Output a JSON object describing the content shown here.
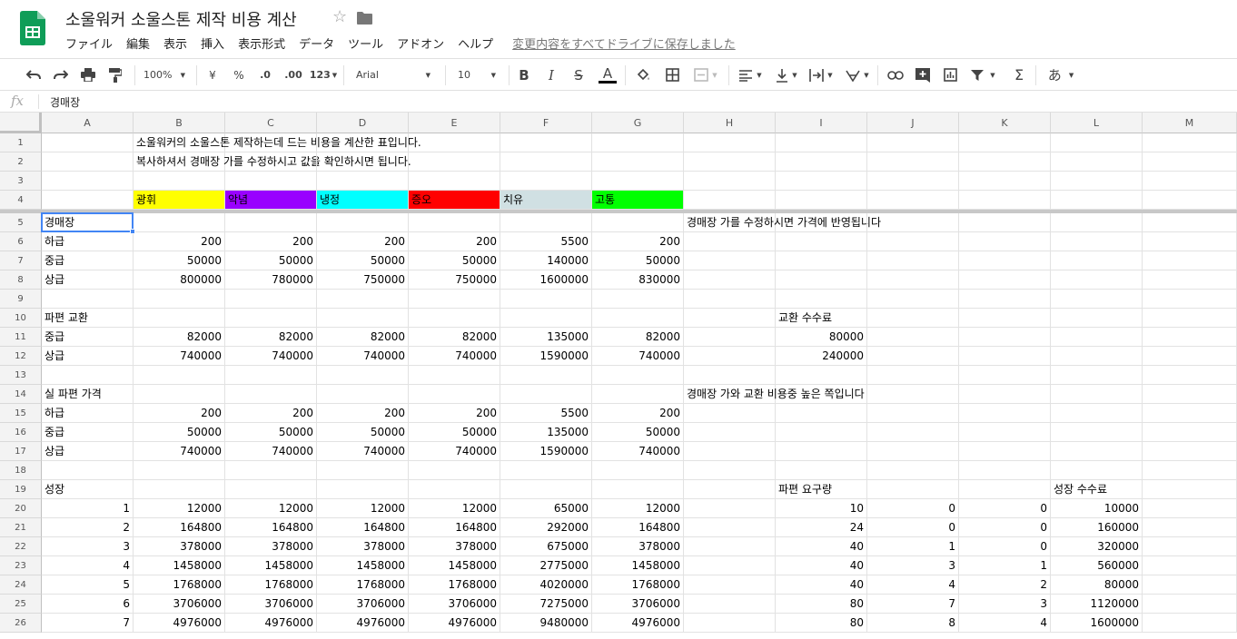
{
  "doc": {
    "title": "소울워커 소울스톤 제작 비용 계산"
  },
  "menu": [
    "ファイル",
    "編集",
    "表示",
    "挿入",
    "表示形式",
    "データ",
    "ツール",
    "アドオン",
    "ヘルプ"
  ],
  "save_status": "変更内容をすべてドライブに保存しました",
  "toolbar": {
    "zoom": "100%",
    "currency": "¥",
    "percent": "%",
    "dec_less": ".0",
    "dec_more": ".00",
    "format_more": "123",
    "font": "Arial",
    "font_size": "10",
    "bold": "B",
    "italic": "I",
    "strike": "S",
    "text_color": "A",
    "input_tools": "あ"
  },
  "formula": {
    "fx": "fx",
    "value": "경매장"
  },
  "columns": [
    "A",
    "B",
    "C",
    "D",
    "E",
    "F",
    "G",
    "H",
    "I",
    "J",
    "K",
    "L",
    "M"
  ],
  "rows": [
    "1",
    "2",
    "3",
    "4",
    "5",
    "6",
    "7",
    "8",
    "9",
    "10",
    "11",
    "12",
    "13",
    "14",
    "15",
    "16",
    "17",
    "18",
    "19",
    "20",
    "21",
    "22",
    "23",
    "24",
    "25",
    "26"
  ],
  "colors": {
    "yellow": "#ffff00",
    "purple": "#9900ff",
    "cyan": "#00ffff",
    "red": "#ff0000",
    "lightgray": "#d0e0e3",
    "green": "#00ff00",
    "selection": "#4285f4"
  },
  "cells": [
    {
      "r": 1,
      "c": "B",
      "t": "소울워커의 소울스톤 제작하는데 드는 비용을 계산한 표입니다."
    },
    {
      "r": 2,
      "c": "B",
      "t": "복사하셔서 경매장 가를 수정하시고 값을 확인하시면 됩니다."
    },
    {
      "r": 4,
      "c": "B",
      "t": "광휘",
      "bg": "yellow"
    },
    {
      "r": 4,
      "c": "C",
      "t": "악념",
      "bg": "purple"
    },
    {
      "r": 4,
      "c": "D",
      "t": "냉정",
      "bg": "cyan"
    },
    {
      "r": 4,
      "c": "E",
      "t": "증오",
      "bg": "red"
    },
    {
      "r": 4,
      "c": "F",
      "t": "치유",
      "bg": "lightgray"
    },
    {
      "r": 4,
      "c": "G",
      "t": "고통",
      "bg": "green"
    },
    {
      "r": 5,
      "c": "A",
      "t": "경매장"
    },
    {
      "r": 5,
      "c": "H",
      "t": "경매장 가를 수정하시면 가격에 반영됩니다"
    },
    {
      "r": 6,
      "c": "A",
      "t": "하급"
    },
    {
      "r": 6,
      "c": "B",
      "t": "200",
      "n": 1
    },
    {
      "r": 6,
      "c": "C",
      "t": "200",
      "n": 1
    },
    {
      "r": 6,
      "c": "D",
      "t": "200",
      "n": 1
    },
    {
      "r": 6,
      "c": "E",
      "t": "200",
      "n": 1
    },
    {
      "r": 6,
      "c": "F",
      "t": "5500",
      "n": 1
    },
    {
      "r": 6,
      "c": "G",
      "t": "200",
      "n": 1
    },
    {
      "r": 7,
      "c": "A",
      "t": "중급"
    },
    {
      "r": 7,
      "c": "B",
      "t": "50000",
      "n": 1
    },
    {
      "r": 7,
      "c": "C",
      "t": "50000",
      "n": 1
    },
    {
      "r": 7,
      "c": "D",
      "t": "50000",
      "n": 1
    },
    {
      "r": 7,
      "c": "E",
      "t": "50000",
      "n": 1
    },
    {
      "r": 7,
      "c": "F",
      "t": "140000",
      "n": 1
    },
    {
      "r": 7,
      "c": "G",
      "t": "50000",
      "n": 1
    },
    {
      "r": 8,
      "c": "A",
      "t": "상급"
    },
    {
      "r": 8,
      "c": "B",
      "t": "800000",
      "n": 1
    },
    {
      "r": 8,
      "c": "C",
      "t": "780000",
      "n": 1
    },
    {
      "r": 8,
      "c": "D",
      "t": "750000",
      "n": 1
    },
    {
      "r": 8,
      "c": "E",
      "t": "750000",
      "n": 1
    },
    {
      "r": 8,
      "c": "F",
      "t": "1600000",
      "n": 1
    },
    {
      "r": 8,
      "c": "G",
      "t": "830000",
      "n": 1
    },
    {
      "r": 10,
      "c": "A",
      "t": "파편 교환"
    },
    {
      "r": 10,
      "c": "I",
      "t": "교환 수수료"
    },
    {
      "r": 11,
      "c": "A",
      "t": "중급"
    },
    {
      "r": 11,
      "c": "B",
      "t": "82000",
      "n": 1
    },
    {
      "r": 11,
      "c": "C",
      "t": "82000",
      "n": 1
    },
    {
      "r": 11,
      "c": "D",
      "t": "82000",
      "n": 1
    },
    {
      "r": 11,
      "c": "E",
      "t": "82000",
      "n": 1
    },
    {
      "r": 11,
      "c": "F",
      "t": "135000",
      "n": 1
    },
    {
      "r": 11,
      "c": "G",
      "t": "82000",
      "n": 1
    },
    {
      "r": 11,
      "c": "I",
      "t": "80000",
      "n": 1
    },
    {
      "r": 12,
      "c": "A",
      "t": "상급"
    },
    {
      "r": 12,
      "c": "B",
      "t": "740000",
      "n": 1
    },
    {
      "r": 12,
      "c": "C",
      "t": "740000",
      "n": 1
    },
    {
      "r": 12,
      "c": "D",
      "t": "740000",
      "n": 1
    },
    {
      "r": 12,
      "c": "E",
      "t": "740000",
      "n": 1
    },
    {
      "r": 12,
      "c": "F",
      "t": "1590000",
      "n": 1
    },
    {
      "r": 12,
      "c": "G",
      "t": "740000",
      "n": 1
    },
    {
      "r": 12,
      "c": "I",
      "t": "240000",
      "n": 1
    },
    {
      "r": 14,
      "c": "A",
      "t": "실 파편 가격"
    },
    {
      "r": 14,
      "c": "H",
      "t": "경매장 가와 교환 비용중 높은 쪽입니다"
    },
    {
      "r": 15,
      "c": "A",
      "t": "하급"
    },
    {
      "r": 15,
      "c": "B",
      "t": "200",
      "n": 1
    },
    {
      "r": 15,
      "c": "C",
      "t": "200",
      "n": 1
    },
    {
      "r": 15,
      "c": "D",
      "t": "200",
      "n": 1
    },
    {
      "r": 15,
      "c": "E",
      "t": "200",
      "n": 1
    },
    {
      "r": 15,
      "c": "F",
      "t": "5500",
      "n": 1
    },
    {
      "r": 15,
      "c": "G",
      "t": "200",
      "n": 1
    },
    {
      "r": 16,
      "c": "A",
      "t": "중급"
    },
    {
      "r": 16,
      "c": "B",
      "t": "50000",
      "n": 1
    },
    {
      "r": 16,
      "c": "C",
      "t": "50000",
      "n": 1
    },
    {
      "r": 16,
      "c": "D",
      "t": "50000",
      "n": 1
    },
    {
      "r": 16,
      "c": "E",
      "t": "50000",
      "n": 1
    },
    {
      "r": 16,
      "c": "F",
      "t": "135000",
      "n": 1
    },
    {
      "r": 16,
      "c": "G",
      "t": "50000",
      "n": 1
    },
    {
      "r": 17,
      "c": "A",
      "t": "상급"
    },
    {
      "r": 17,
      "c": "B",
      "t": "740000",
      "n": 1
    },
    {
      "r": 17,
      "c": "C",
      "t": "740000",
      "n": 1
    },
    {
      "r": 17,
      "c": "D",
      "t": "740000",
      "n": 1
    },
    {
      "r": 17,
      "c": "E",
      "t": "740000",
      "n": 1
    },
    {
      "r": 17,
      "c": "F",
      "t": "1590000",
      "n": 1
    },
    {
      "r": 17,
      "c": "G",
      "t": "740000",
      "n": 1
    },
    {
      "r": 19,
      "c": "A",
      "t": "성장"
    },
    {
      "r": 19,
      "c": "I",
      "t": "파편 요구량"
    },
    {
      "r": 19,
      "c": "L",
      "t": "성장 수수료"
    },
    {
      "r": 20,
      "c": "A",
      "t": "1",
      "n": 1
    },
    {
      "r": 20,
      "c": "B",
      "t": "12000",
      "n": 1
    },
    {
      "r": 20,
      "c": "C",
      "t": "12000",
      "n": 1
    },
    {
      "r": 20,
      "c": "D",
      "t": "12000",
      "n": 1
    },
    {
      "r": 20,
      "c": "E",
      "t": "12000",
      "n": 1
    },
    {
      "r": 20,
      "c": "F",
      "t": "65000",
      "n": 1
    },
    {
      "r": 20,
      "c": "G",
      "t": "12000",
      "n": 1
    },
    {
      "r": 20,
      "c": "I",
      "t": "10",
      "n": 1
    },
    {
      "r": 20,
      "c": "J",
      "t": "0",
      "n": 1
    },
    {
      "r": 20,
      "c": "K",
      "t": "0",
      "n": 1
    },
    {
      "r": 20,
      "c": "L",
      "t": "10000",
      "n": 1
    },
    {
      "r": 21,
      "c": "A",
      "t": "2",
      "n": 1
    },
    {
      "r": 21,
      "c": "B",
      "t": "164800",
      "n": 1
    },
    {
      "r": 21,
      "c": "C",
      "t": "164800",
      "n": 1
    },
    {
      "r": 21,
      "c": "D",
      "t": "164800",
      "n": 1
    },
    {
      "r": 21,
      "c": "E",
      "t": "164800",
      "n": 1
    },
    {
      "r": 21,
      "c": "F",
      "t": "292000",
      "n": 1
    },
    {
      "r": 21,
      "c": "G",
      "t": "164800",
      "n": 1
    },
    {
      "r": 21,
      "c": "I",
      "t": "24",
      "n": 1
    },
    {
      "r": 21,
      "c": "J",
      "t": "0",
      "n": 1
    },
    {
      "r": 21,
      "c": "K",
      "t": "0",
      "n": 1
    },
    {
      "r": 21,
      "c": "L",
      "t": "160000",
      "n": 1
    },
    {
      "r": 22,
      "c": "A",
      "t": "3",
      "n": 1
    },
    {
      "r": 22,
      "c": "B",
      "t": "378000",
      "n": 1
    },
    {
      "r": 22,
      "c": "C",
      "t": "378000",
      "n": 1
    },
    {
      "r": 22,
      "c": "D",
      "t": "378000",
      "n": 1
    },
    {
      "r": 22,
      "c": "E",
      "t": "378000",
      "n": 1
    },
    {
      "r": 22,
      "c": "F",
      "t": "675000",
      "n": 1
    },
    {
      "r": 22,
      "c": "G",
      "t": "378000",
      "n": 1
    },
    {
      "r": 22,
      "c": "I",
      "t": "40",
      "n": 1
    },
    {
      "r": 22,
      "c": "J",
      "t": "1",
      "n": 1
    },
    {
      "r": 22,
      "c": "K",
      "t": "0",
      "n": 1
    },
    {
      "r": 22,
      "c": "L",
      "t": "320000",
      "n": 1
    },
    {
      "r": 23,
      "c": "A",
      "t": "4",
      "n": 1
    },
    {
      "r": 23,
      "c": "B",
      "t": "1458000",
      "n": 1
    },
    {
      "r": 23,
      "c": "C",
      "t": "1458000",
      "n": 1
    },
    {
      "r": 23,
      "c": "D",
      "t": "1458000",
      "n": 1
    },
    {
      "r": 23,
      "c": "E",
      "t": "1458000",
      "n": 1
    },
    {
      "r": 23,
      "c": "F",
      "t": "2775000",
      "n": 1
    },
    {
      "r": 23,
      "c": "G",
      "t": "1458000",
      "n": 1
    },
    {
      "r": 23,
      "c": "I",
      "t": "40",
      "n": 1
    },
    {
      "r": 23,
      "c": "J",
      "t": "3",
      "n": 1
    },
    {
      "r": 23,
      "c": "K",
      "t": "1",
      "n": 1
    },
    {
      "r": 23,
      "c": "L",
      "t": "560000",
      "n": 1
    },
    {
      "r": 24,
      "c": "A",
      "t": "5",
      "n": 1
    },
    {
      "r": 24,
      "c": "B",
      "t": "1768000",
      "n": 1
    },
    {
      "r": 24,
      "c": "C",
      "t": "1768000",
      "n": 1
    },
    {
      "r": 24,
      "c": "D",
      "t": "1768000",
      "n": 1
    },
    {
      "r": 24,
      "c": "E",
      "t": "1768000",
      "n": 1
    },
    {
      "r": 24,
      "c": "F",
      "t": "4020000",
      "n": 1
    },
    {
      "r": 24,
      "c": "G",
      "t": "1768000",
      "n": 1
    },
    {
      "r": 24,
      "c": "I",
      "t": "40",
      "n": 1
    },
    {
      "r": 24,
      "c": "J",
      "t": "4",
      "n": 1
    },
    {
      "r": 24,
      "c": "K",
      "t": "2",
      "n": 1
    },
    {
      "r": 24,
      "c": "L",
      "t": "80000",
      "n": 1
    },
    {
      "r": 25,
      "c": "A",
      "t": "6",
      "n": 1
    },
    {
      "r": 25,
      "c": "B",
      "t": "3706000",
      "n": 1
    },
    {
      "r": 25,
      "c": "C",
      "t": "3706000",
      "n": 1
    },
    {
      "r": 25,
      "c": "D",
      "t": "3706000",
      "n": 1
    },
    {
      "r": 25,
      "c": "E",
      "t": "3706000",
      "n": 1
    },
    {
      "r": 25,
      "c": "F",
      "t": "7275000",
      "n": 1
    },
    {
      "r": 25,
      "c": "G",
      "t": "3706000",
      "n": 1
    },
    {
      "r": 25,
      "c": "I",
      "t": "80",
      "n": 1
    },
    {
      "r": 25,
      "c": "J",
      "t": "7",
      "n": 1
    },
    {
      "r": 25,
      "c": "K",
      "t": "3",
      "n": 1
    },
    {
      "r": 25,
      "c": "L",
      "t": "1120000",
      "n": 1
    },
    {
      "r": 26,
      "c": "A",
      "t": "7",
      "n": 1
    },
    {
      "r": 26,
      "c": "B",
      "t": "4976000",
      "n": 1
    },
    {
      "r": 26,
      "c": "C",
      "t": "4976000",
      "n": 1
    },
    {
      "r": 26,
      "c": "D",
      "t": "4976000",
      "n": 1
    },
    {
      "r": 26,
      "c": "E",
      "t": "4976000",
      "n": 1
    },
    {
      "r": 26,
      "c": "F",
      "t": "9480000",
      "n": 1
    },
    {
      "r": 26,
      "c": "G",
      "t": "4976000",
      "n": 1
    },
    {
      "r": 26,
      "c": "I",
      "t": "80",
      "n": 1
    },
    {
      "r": 26,
      "c": "J",
      "t": "8",
      "n": 1
    },
    {
      "r": 26,
      "c": "K",
      "t": "4",
      "n": 1
    },
    {
      "r": 26,
      "c": "L",
      "t": "1600000",
      "n": 1
    }
  ],
  "selected_cell": "A5"
}
